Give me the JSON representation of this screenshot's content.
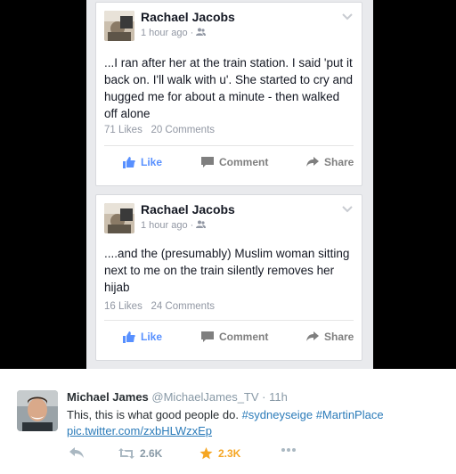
{
  "facebook_posts": [
    {
      "author": "Rachael Jacobs",
      "time": "1 hour ago",
      "separator": "·",
      "text": "...I ran after her at the train station. I said 'put it back on. I'll walk with u'. She started to cry and hugged me for about a minute - then walked off alone",
      "likes": "71 Likes",
      "comments": "20 Comments"
    },
    {
      "author": "Rachael Jacobs",
      "time": "1 hour ago",
      "separator": "·",
      "text": "....and the (presumably) Muslim woman sitting next to me on the train silently removes her hijab",
      "likes": "16 Likes",
      "comments": "24 Comments"
    }
  ],
  "fb_actions": {
    "like": "Like",
    "comment": "Comment",
    "share": "Share"
  },
  "tweet": {
    "name": "Michael James",
    "handle": "@MichaelJames_TV",
    "dot": "·",
    "time": "11h",
    "text_plain": "This, this is what good people do.",
    "hashtag1": "#sydneyseige",
    "hashtag2": "#MartinPlace",
    "link": "pic.twitter.com/zxbHLWzxEp",
    "retweets": "2.6K",
    "favorites": "2.3K"
  },
  "colors": {
    "fb_like_blue": "#5890ff",
    "twitter_link": "#2b7bb9",
    "favorite_star": "#f5a623"
  }
}
